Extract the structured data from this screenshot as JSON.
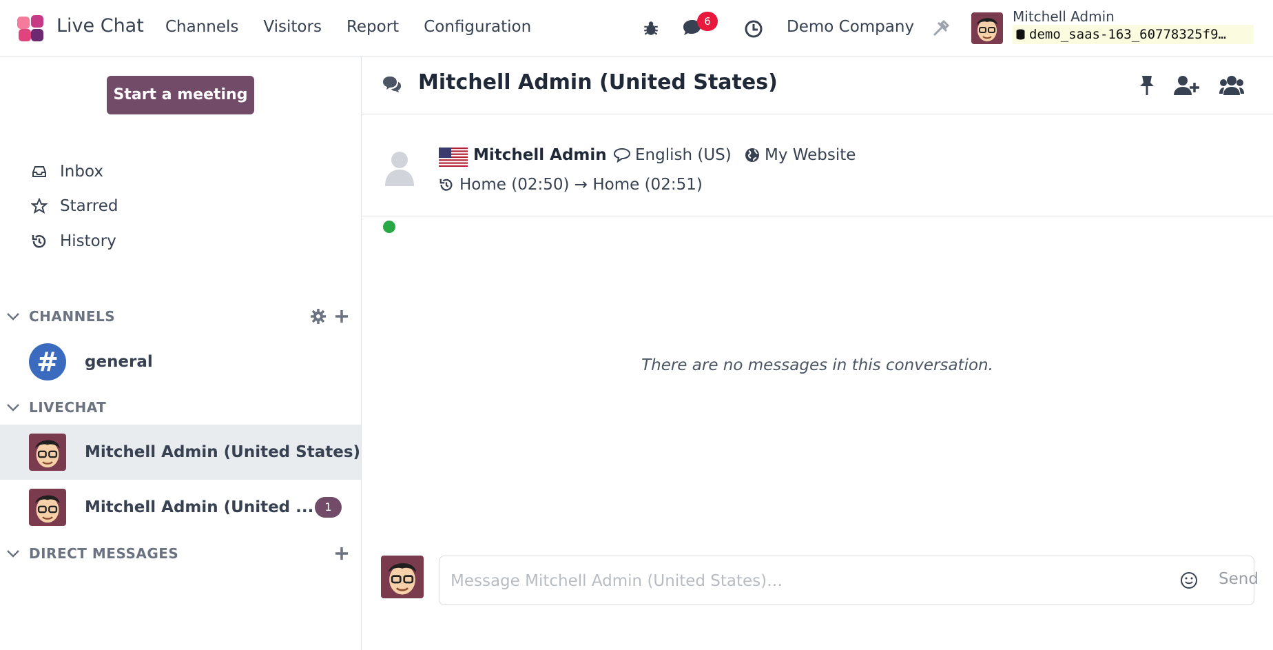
{
  "navbar": {
    "app_name": "Live Chat",
    "menu": [
      "Channels",
      "Visitors",
      "Report",
      "Configuration"
    ],
    "messages_badge": "6",
    "company": "Demo Company",
    "user_name": "Mitchell Admin",
    "db_name": "demo_saas-163_60778325f9…"
  },
  "sidebar": {
    "start_meeting": "Start a meeting",
    "nav": [
      "Inbox",
      "Starred",
      "History"
    ],
    "channels_header": "CHANNELS",
    "channels": [
      "general"
    ],
    "livechat_header": "LIVECHAT",
    "livechats": [
      {
        "label": "Mitchell Admin (United States)",
        "badge": ""
      },
      {
        "label": "Mitchell Admin (United ...",
        "badge": "1"
      }
    ],
    "dm_header": "DIRECT MESSAGES"
  },
  "thread": {
    "title": "Mitchell Admin (United States)",
    "visitor_name": "Mitchell Admin",
    "language": "English (US)",
    "website": "My Website",
    "history": "Home (02:50) → Home (02:51)",
    "empty": "There are no messages in this conversation.",
    "composer_placeholder": "Message Mitchell Admin (United States)…",
    "send": "Send"
  },
  "colors": {
    "brand": "#714b67",
    "badge_red": "#e8193c",
    "online": "#28a745",
    "channel_blue": "#3b6bbf"
  }
}
